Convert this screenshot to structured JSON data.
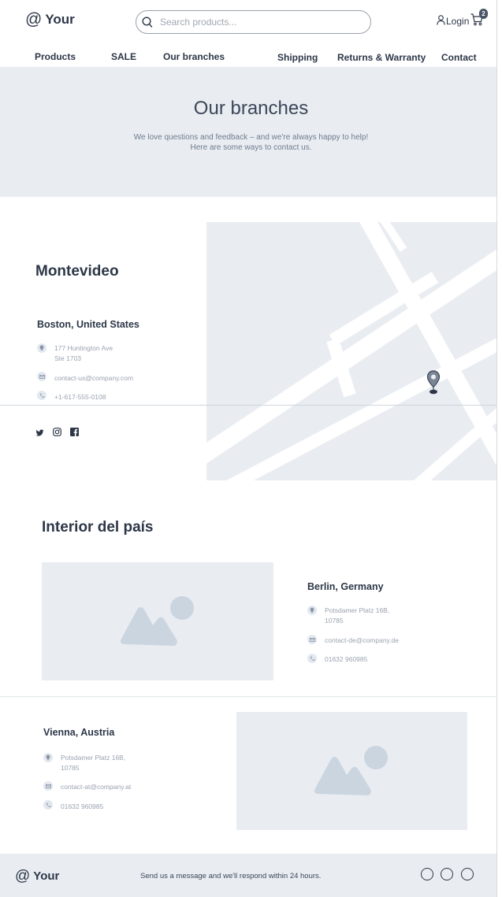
{
  "header": {
    "logo_symbol": "@",
    "logo_text": "Your",
    "search_placeholder": "Search products...",
    "login_label": "Login",
    "cart_count": "2"
  },
  "nav": {
    "products": "Products",
    "sale": "SALE",
    "branches": "Our branches",
    "shipping": "Shipping",
    "returns": "Returns & Warranty",
    "contact": "Contact"
  },
  "hero": {
    "title": "Our branches",
    "line1": "We love questions and feedback – and we're always happy to help!",
    "line2": "Here are some ways to contact us."
  },
  "montevideo": {
    "heading": "Montevideo",
    "office": "Boston, United States",
    "address_line1": "177 Huntington Ave",
    "address_line2": "Ste 1703",
    "email": "contact-us@company.com",
    "phone": "+1-617-555-0108"
  },
  "interior": {
    "heading": "Interior del país",
    "offices": [
      {
        "name": "Berlin, Germany",
        "address_line1": "Potsdamer Platz 16B,",
        "address_line2": "10785",
        "email": "contact-de@company.de",
        "phone": "01632 960985"
      },
      {
        "name": "Vienna, Austria",
        "address_line1": "Potsdamer Platz 16B,",
        "address_line2": "10785",
        "email": "contact-at@company.at",
        "phone": "01632 960985"
      }
    ]
  },
  "footer": {
    "logo_symbol": "@",
    "logo_text": "Your",
    "message": "Send us a message and we'll respond within 24 hours."
  },
  "icons": {
    "search": "search-icon",
    "user": "user-icon",
    "cart": "cart-icon",
    "location": "location-pin-icon",
    "email": "mail-icon",
    "phone": "phone-icon",
    "twitter": "twitter-icon",
    "instagram": "instagram-icon",
    "facebook": "facebook-icon",
    "image_placeholder": "image-placeholder-icon"
  },
  "colors": {
    "text": "#2d3748",
    "muted": "#9aa3b0",
    "panel": "#e9edf2",
    "placeholder_shape": "#cbd5e0"
  }
}
